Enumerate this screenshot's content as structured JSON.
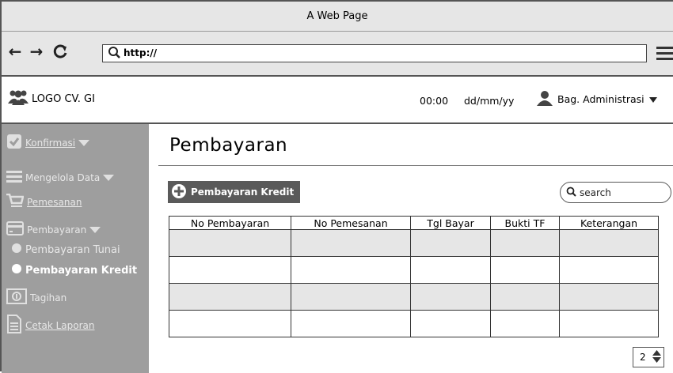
{
  "browser": {
    "title": "A Web Page",
    "url": "http://"
  },
  "header": {
    "logo_text": "LOGO CV. GI",
    "time": "00:00",
    "date": "dd/mm/yy",
    "user_label": "Bag. Administrasi"
  },
  "sidebar": {
    "items": [
      {
        "label": "Konfirmasi",
        "icon": "check-icon"
      },
      {
        "label": "Mengelola Data",
        "icon": "hamburger-icon"
      },
      {
        "label": "Pemesanan",
        "icon": "cart-icon"
      },
      {
        "label": "Pembayaran",
        "icon": "card-icon"
      },
      {
        "label": "Pembayaran Tunai",
        "icon": "dot-icon"
      },
      {
        "label": "Pembayaran Kredit",
        "icon": "dot-icon"
      },
      {
        "label": "Tagihan",
        "icon": "bill-icon"
      },
      {
        "label": "Cetak Laporan",
        "icon": "document-icon"
      }
    ]
  },
  "main": {
    "title": "Pembayaran",
    "add_button": "Pembayaran Kredit",
    "search_placeholder": "search",
    "table": {
      "columns": [
        "No Pembayaran",
        "No Pemesanan",
        "Tgl Bayar",
        "Bukti TF",
        "Keterangan"
      ],
      "rows": [
        [
          "",
          "",
          "",
          "",
          ""
        ],
        [
          "",
          "",
          "",
          "",
          ""
        ],
        [
          "",
          "",
          "",
          "",
          ""
        ],
        [
          "",
          "",
          "",
          "",
          ""
        ]
      ]
    },
    "pager_value": "2"
  },
  "colors": {
    "sidebar_bg": "#9e9e9e",
    "button_bg": "#5a5a5a",
    "row_alt": "#e6e6e6"
  }
}
